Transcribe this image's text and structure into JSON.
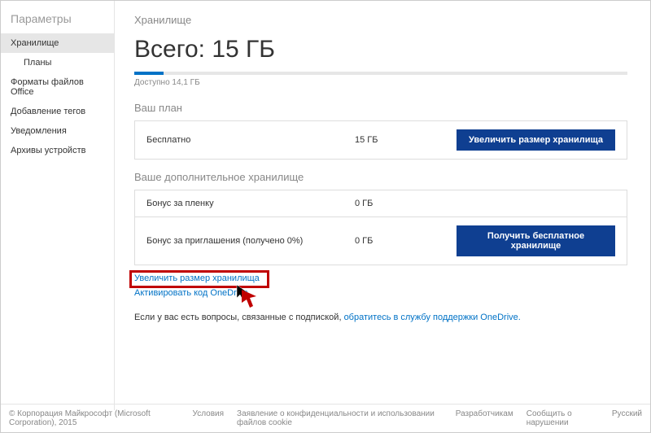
{
  "sidebar": {
    "title": "Параметры",
    "items": [
      {
        "label": "Хранилище",
        "active": true,
        "indent": false
      },
      {
        "label": "Планы",
        "active": false,
        "indent": true
      },
      {
        "label": "Форматы файлов Office",
        "active": false,
        "indent": false
      },
      {
        "label": "Добавление тегов",
        "active": false,
        "indent": false
      },
      {
        "label": "Уведомления",
        "active": false,
        "indent": false
      },
      {
        "label": "Архивы устройств",
        "active": false,
        "indent": false
      }
    ]
  },
  "main": {
    "heading": "Хранилище",
    "total": "Всего: 15 ГБ",
    "available": "Доступно 14,1 ГБ",
    "plan_section": "Ваш план",
    "plan_rows": [
      {
        "name": "Бесплатно",
        "size": "15 ГБ",
        "action": "Увеличить размер хранилища"
      }
    ],
    "extra_section": "Ваше дополнительное хранилище",
    "extra_rows": [
      {
        "name": "Бонус за пленку",
        "size": "0 ГБ",
        "action": ""
      },
      {
        "name": "Бонус за приглашения (получено 0%)",
        "size": "0 ГБ",
        "action": "Получить бесплатное хранилище"
      }
    ],
    "link_increase": "Увеличить размер хранилища",
    "link_activate": "Активировать код OneDrive",
    "support_prefix": "Если у вас есть вопросы, связанные с подпиской, ",
    "support_link": "обратитесь в службу поддержки OneDrive."
  },
  "footer": {
    "copyright": "© Корпорация Майкрософт (Microsoft Corporation), 2015",
    "terms": "Условия",
    "privacy": "Заявление о конфиденциальности и использовании файлов cookie",
    "devs": "Разработчикам",
    "report": "Сообщить о нарушении",
    "lang": "Русский"
  }
}
